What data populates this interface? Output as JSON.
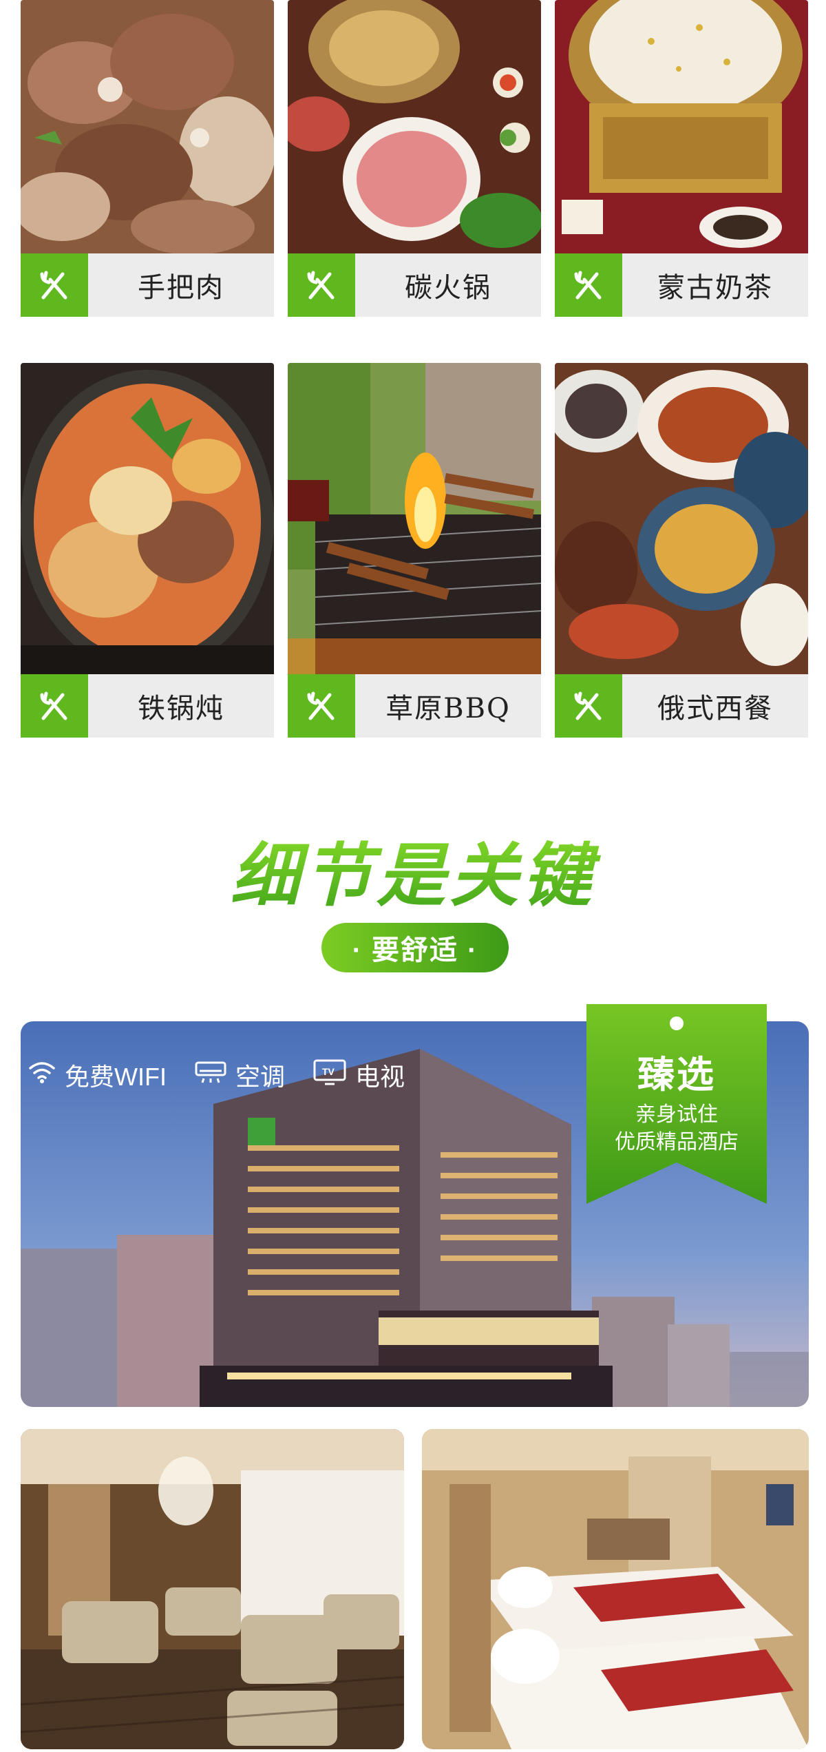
{
  "dishes": [
    {
      "name": "手把肉"
    },
    {
      "name": "碳火锅"
    },
    {
      "name": "蒙古奶茶"
    },
    {
      "name": "铁锅炖"
    },
    {
      "name": "草原BBQ"
    },
    {
      "name": "俄式西餐"
    }
  ],
  "section": {
    "headline": "细节是关键",
    "pill": "· 要舒适 ·"
  },
  "amenities": [
    {
      "label": "免费WIFI",
      "icon": "wifi-icon"
    },
    {
      "label": "空调",
      "icon": "air-conditioner-icon"
    },
    {
      "label": "电视",
      "icon": "tv-icon"
    }
  ],
  "badge": {
    "title": "臻选",
    "line1": "亲身试住",
    "line2": "优质精品酒店"
  },
  "colors": {
    "accent": "#5fb81e",
    "accent_dark": "#3d9a16",
    "label_bg": "#ececec"
  }
}
